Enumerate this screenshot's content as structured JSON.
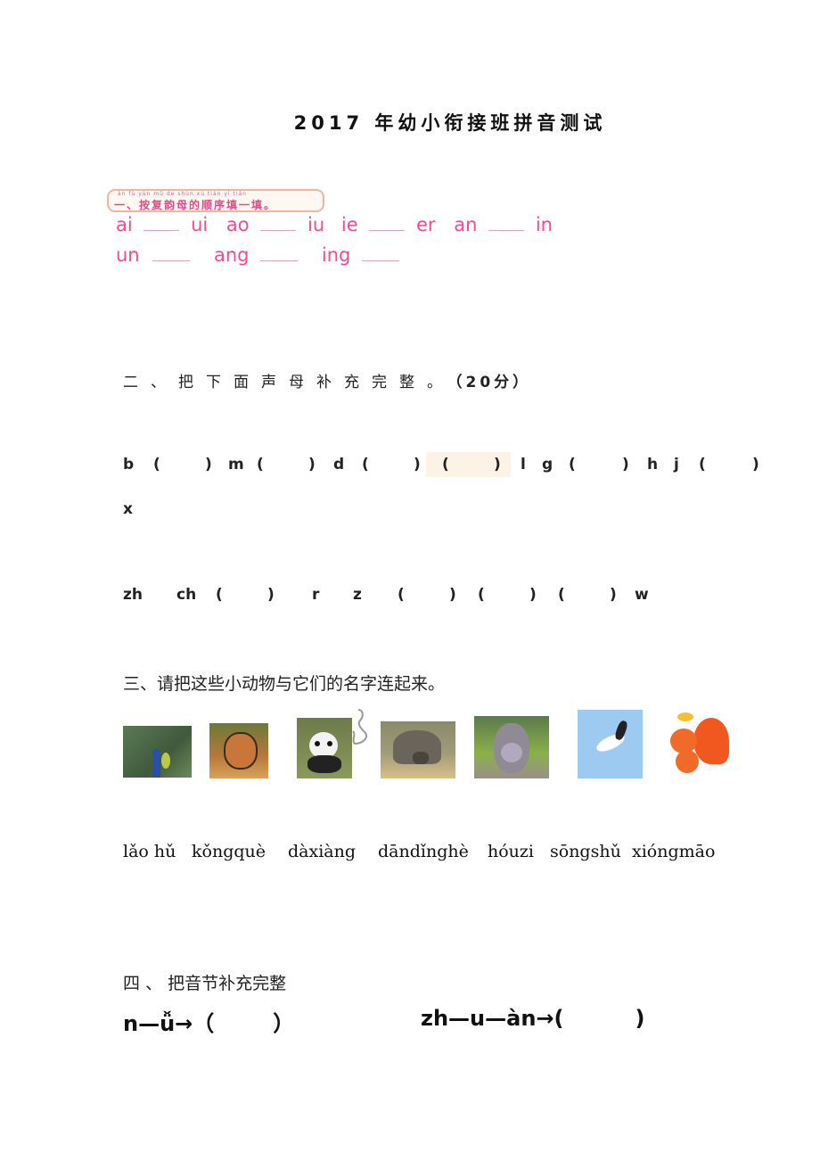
{
  "title": "2017 年幼小衔接班拼音测试",
  "section1": {
    "banner_pinyin": "àn   fù   yùn   mǔ   de   shùn  xù   tián   yì   tián",
    "banner_text": "一、按复韵母的顺序填一填。",
    "row1": [
      "ai",
      "ui",
      "ao",
      "iu",
      "ie",
      "er",
      "an",
      "in"
    ],
    "row2": [
      "un",
      "ang",
      "ing"
    ]
  },
  "section2": {
    "heading": "二、把下面声母补充完整。",
    "score": "（20分）",
    "row1": [
      "b",
      "(",
      ")",
      "m",
      "(",
      ")",
      "d",
      "(",
      ")",
      "(",
      ")",
      "l",
      "g",
      "(",
      ")",
      "h",
      "j",
      "(",
      ")"
    ],
    "row1_wrap": "x",
    "row2": [
      "zh",
      "ch",
      "(",
      ")",
      "r",
      "z",
      "(",
      ")",
      "(",
      ")",
      "(",
      ")",
      "w"
    ]
  },
  "section3": {
    "heading": "三、请把这些小动物与它们的名字连起来。",
    "animals": [
      {
        "name": "peacock-image",
        "colors": [
          "#4a6b45",
          "#2a4fa8"
        ]
      },
      {
        "name": "tiger-image",
        "colors": [
          "#6b7a3a",
          "#d58a3a"
        ]
      },
      {
        "name": "panda-image",
        "colors": [
          "#6e7a4a",
          "#f2f2f2"
        ]
      },
      {
        "name": "elephant-image",
        "colors": [
          "#8a8a6a",
          "#c9a97a"
        ]
      },
      {
        "name": "monkey-image",
        "colors": [
          "#6a8a4a",
          "#9a8f9a"
        ]
      },
      {
        "name": "crane-image",
        "colors": [
          "#9ccaf0",
          "#ffffff"
        ]
      },
      {
        "name": "squirrel-image",
        "colors": [
          "#ffffff",
          "#f0581f"
        ]
      }
    ],
    "pinyin": [
      "lǎo hǔ",
      "kǒngquè",
      "dàxiàng",
      "dāndǐnghè",
      "hóuzi",
      "sōngshǔ",
      "xióngmāo"
    ]
  },
  "section4": {
    "heading": "四 、 把音节补充完整",
    "item1": "n—ǚ→（",
    "item1_close": "）",
    "item2": "zh—u—àn→(",
    "item2_close": ")"
  }
}
